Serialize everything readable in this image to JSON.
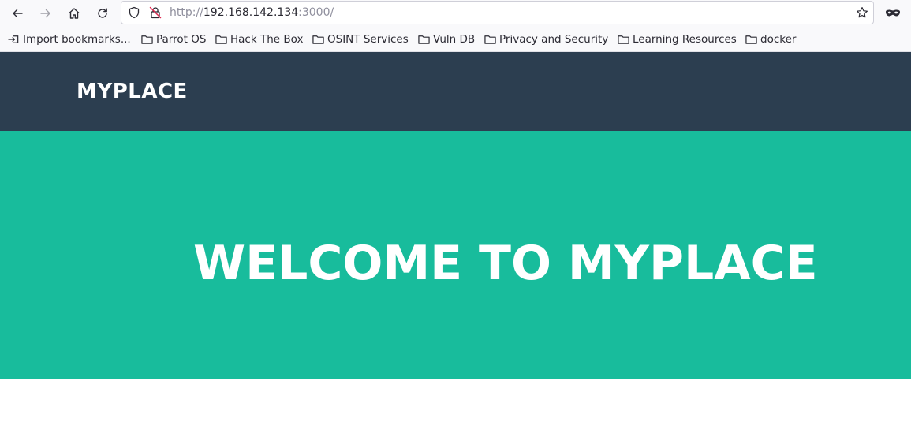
{
  "browser": {
    "url_prefix": "http://",
    "url_host": "192.168.142.134",
    "url_suffix": ":3000/"
  },
  "bookmarks": [
    {
      "label": "Import bookmarks...",
      "icon": "import-icon"
    },
    {
      "label": "Parrot OS",
      "icon": "folder-icon"
    },
    {
      "label": "Hack The Box",
      "icon": "folder-icon"
    },
    {
      "label": "OSINT Services",
      "icon": "folder-icon"
    },
    {
      "label": "Vuln DB",
      "icon": "folder-icon"
    },
    {
      "label": "Privacy and Security",
      "icon": "folder-icon"
    },
    {
      "label": "Learning Resources",
      "icon": "folder-icon"
    },
    {
      "label": "docker",
      "icon": "folder-icon"
    }
  ],
  "site": {
    "logo": "MYPLACE",
    "hero_title": "WELCOME TO MYPLACE"
  },
  "colors": {
    "header_bg": "#2c3e50",
    "hero_bg": "#18bc9c",
    "text_white": "#ffffff"
  }
}
